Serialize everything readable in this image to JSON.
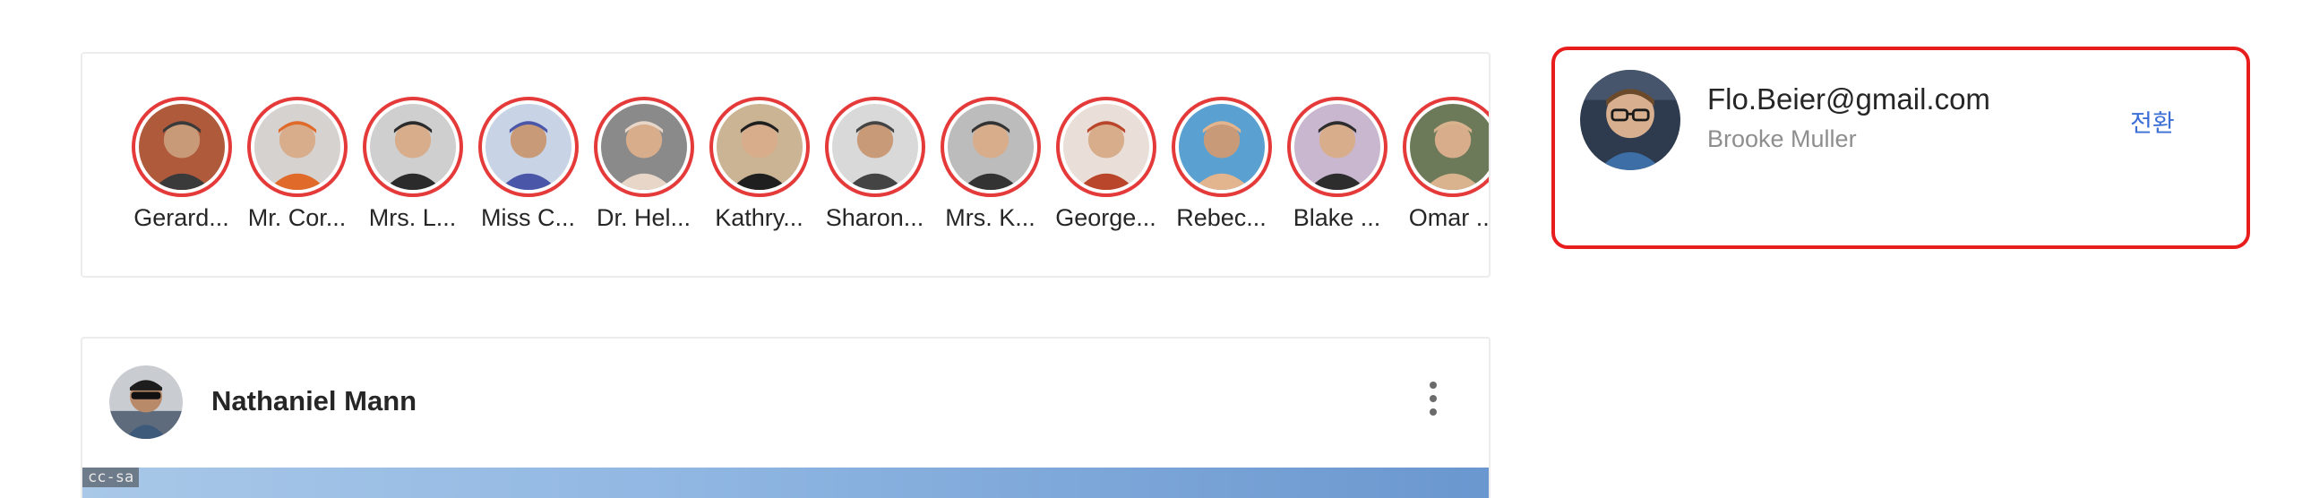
{
  "stories": [
    {
      "name": "Gerard...",
      "avatar": "abstract-portrait-avatar",
      "bg": "#b05a3c",
      "fg": "#3a3a3a"
    },
    {
      "name": "Mr. Cor...",
      "avatar": "orange-jacket-avatar",
      "bg": "#d6d2cf",
      "fg": "#e06a2a"
    },
    {
      "name": "Mrs. L...",
      "avatar": "bearded-man-avatar",
      "bg": "#cfcfcf",
      "fg": "#2b2b2b"
    },
    {
      "name": "Miss C...",
      "avatar": "blue-shirt-avatar",
      "bg": "#c8d3e6",
      "fg": "#4a56a8"
    },
    {
      "name": "Dr. Hel...",
      "avatar": "young-man-avatar",
      "bg": "#8a8a8a",
      "fg": "#e8d6c8"
    },
    {
      "name": "Kathry...",
      "avatar": "mustache-man-avatar",
      "bg": "#cbb493",
      "fg": "#1f1f1f"
    },
    {
      "name": "Sharon...",
      "avatar": "dreadlocks-avatar",
      "bg": "#d9d9d9",
      "fg": "#444444"
    },
    {
      "name": "Mrs. K...",
      "avatar": "binocular-viewer-avatar",
      "bg": "#bcbcbc",
      "fg": "#333333"
    },
    {
      "name": "George...",
      "avatar": "red-hair-woman-avatar",
      "bg": "#eadfd8",
      "fg": "#b9452b"
    },
    {
      "name": "Rebec...",
      "avatar": "smiling-face-avatar",
      "bg": "#5aa0d0",
      "fg": "#e3b58e"
    },
    {
      "name": "Blake ...",
      "avatar": "cap-man-avatar",
      "bg": "#c9b7cf",
      "fg": "#2d2d2d"
    },
    {
      "name": "Omar ...",
      "avatar": "bald-man-avatar",
      "bg": "#6d7a5a",
      "fg": "#d8b38e"
    }
  ],
  "post": {
    "author": "Nathaniel Mann",
    "avatar": "sunglasses-man-avatar",
    "image_badge": "cc-sa"
  },
  "account": {
    "email": "Flo.Beier@gmail.com",
    "name": "Brooke Muller",
    "switch_label": "전환",
    "avatar": "glasses-man-avatar"
  },
  "colors": {
    "story_ring": "#e53a3a",
    "highlight_border": "#e81d1d",
    "link": "#3b6fd6"
  }
}
